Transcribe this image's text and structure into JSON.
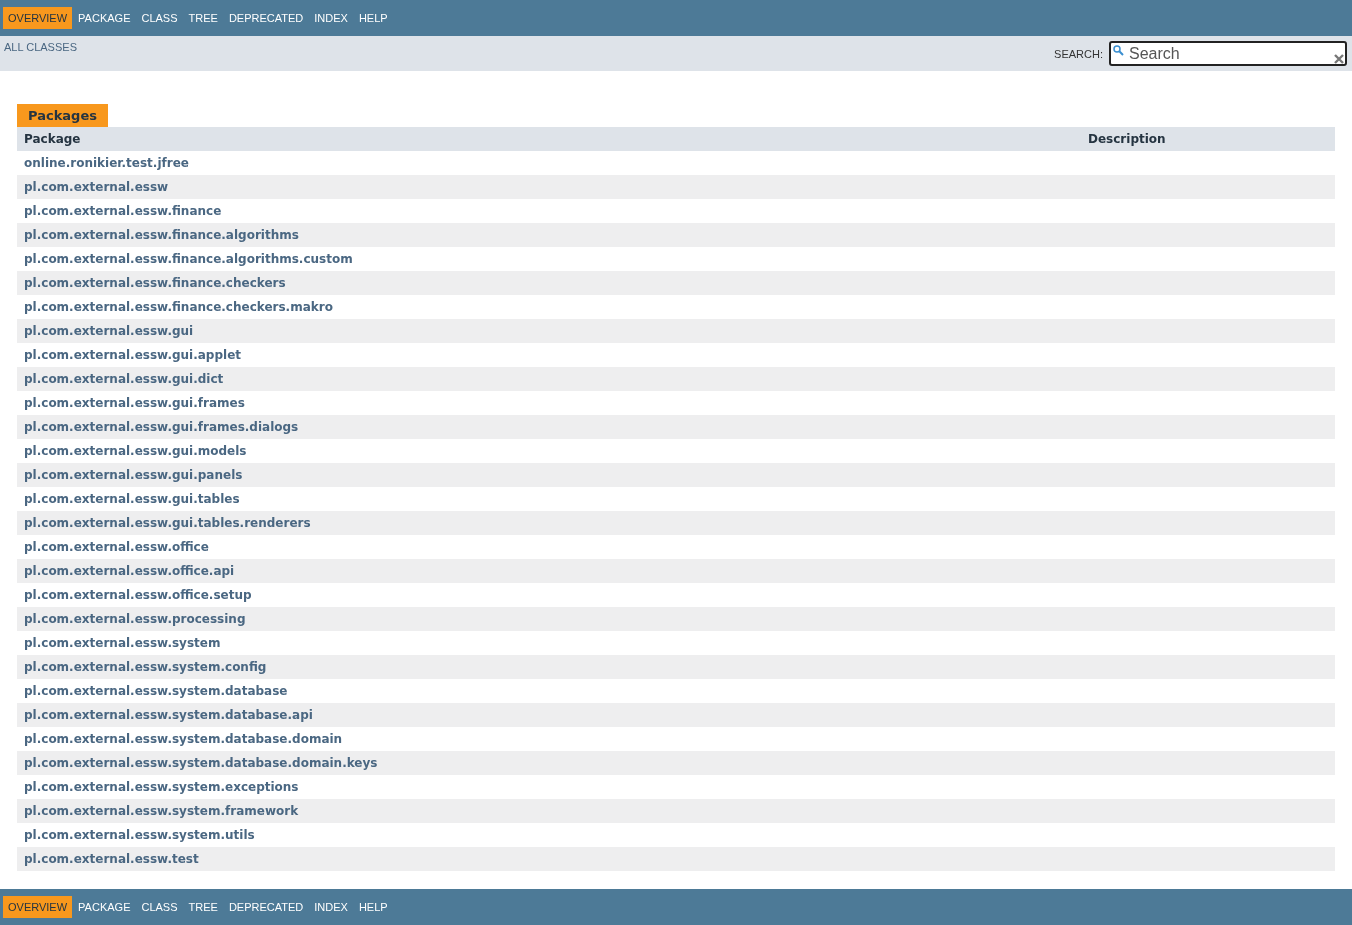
{
  "top_nav": {
    "items": [
      {
        "label": "OVERVIEW",
        "selected": true
      },
      {
        "label": "PACKAGE",
        "selected": false
      },
      {
        "label": "CLASS",
        "selected": false
      },
      {
        "label": "TREE",
        "selected": false
      },
      {
        "label": "DEPRECATED",
        "selected": false
      },
      {
        "label": "INDEX",
        "selected": false
      },
      {
        "label": "HELP",
        "selected": false
      }
    ]
  },
  "sub_nav": {
    "all_classes": "ALL CLASSES",
    "search_label": "SEARCH:",
    "search_value": "Search"
  },
  "table": {
    "caption": "Packages",
    "columns": [
      "Package",
      "Description"
    ],
    "rows": [
      "online.ronikier.test.jfree",
      "pl.com.external.essw",
      "pl.com.external.essw.finance",
      "pl.com.external.essw.finance.algorithms",
      "pl.com.external.essw.finance.algorithms.custom",
      "pl.com.external.essw.finance.checkers",
      "pl.com.external.essw.finance.checkers.makro",
      "pl.com.external.essw.gui",
      "pl.com.external.essw.gui.applet",
      "pl.com.external.essw.gui.dict",
      "pl.com.external.essw.gui.frames",
      "pl.com.external.essw.gui.frames.dialogs",
      "pl.com.external.essw.gui.models",
      "pl.com.external.essw.gui.panels",
      "pl.com.external.essw.gui.tables",
      "pl.com.external.essw.gui.tables.renderers",
      "pl.com.external.essw.office",
      "pl.com.external.essw.office.api",
      "pl.com.external.essw.office.setup",
      "pl.com.external.essw.processing",
      "pl.com.external.essw.system",
      "pl.com.external.essw.system.config",
      "pl.com.external.essw.system.database",
      "pl.com.external.essw.system.database.api",
      "pl.com.external.essw.system.database.domain",
      "pl.com.external.essw.system.database.domain.keys",
      "pl.com.external.essw.system.exceptions",
      "pl.com.external.essw.system.framework",
      "pl.com.external.essw.system.utils",
      "pl.com.external.essw.test"
    ]
  },
  "bottom_nav": {
    "items": [
      {
        "label": "OVERVIEW",
        "selected": true
      },
      {
        "label": "PACKAGE",
        "selected": false
      },
      {
        "label": "CLASS",
        "selected": false
      },
      {
        "label": "TREE",
        "selected": false
      },
      {
        "label": "DEPRECATED",
        "selected": false
      },
      {
        "label": "INDEX",
        "selected": false
      },
      {
        "label": "HELP",
        "selected": false
      }
    ]
  }
}
